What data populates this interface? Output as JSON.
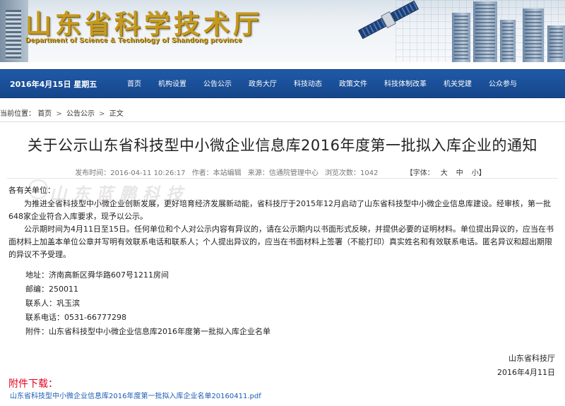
{
  "header": {
    "title": "山东省科学技术厅",
    "subtitle": "Department of Science & Technology of Shandong province"
  },
  "nav": {
    "date": "2016年4月15日 星期五",
    "items": [
      "首页",
      "机构设置",
      "公告公示",
      "政务大厅",
      "科技动态",
      "政策文件",
      "科技体制改革",
      "机关党建",
      "公众参与"
    ]
  },
  "breadcrumb": {
    "label": "当前位置：",
    "items": [
      "首页",
      "公告公示",
      "正文"
    ],
    "separator": ">"
  },
  "article": {
    "title": "关于公示山东省科技型中小微企业信息库2016年度第一批拟入库企业的通知",
    "meta": {
      "publish_time": "发布时间：2016-04-11 10:26:17",
      "author": "作者：本站编辑",
      "source": "来源：信通院管理中心",
      "views": "浏览次数：1042",
      "font_label": "【字体：",
      "font_large": "大",
      "font_medium": "中",
      "font_small": "小】"
    },
    "salutation": "各有关单位：",
    "paragraph1": "为推进全省科技型中小微企业创新发展，更好培育经济发展新动能，省科技厅于2015年12月启动了山东省科技型中小微企业信息库建设。经审核，第一批648家企业符合入库要求，现予以公示。",
    "paragraph2": "公示期时间为4月11日至15日。任何单位和个人对公示内容有异议的，请在公示期内以书面形式反映，并提供必要的证明材料。单位提出异议的，应当在书面材料上加盖本单位公章并写明有效联系电话和联系人；个人提出异议的，应当在书面材料上签署（不能打印）真实姓名和有效联系电话。匿名异议和超出期限的异议不予受理。",
    "address": "地址：济南高新区舜华路607号1211房间",
    "postcode": "邮编：250011",
    "contact": "联系人：巩玉滨",
    "phone": "联系电话：0531-66777298",
    "attachment_note": "附件：山东省科技型中小微企业信息库2016年度第一批拟入库企业名单",
    "signature_org": "山东省科技厅",
    "signature_date": "2016年4月11日"
  },
  "downloads": {
    "label": "附件下载：",
    "file": "山东省科技型中小微企业信息库2016年度第一批拟入库企业名单20160411.pdf"
  },
  "colors": {
    "nav_bg": "#1a4f99",
    "title_gold": "#c59a1e",
    "attach_red": "#e8001c",
    "link_blue": "#1a5bb5"
  }
}
